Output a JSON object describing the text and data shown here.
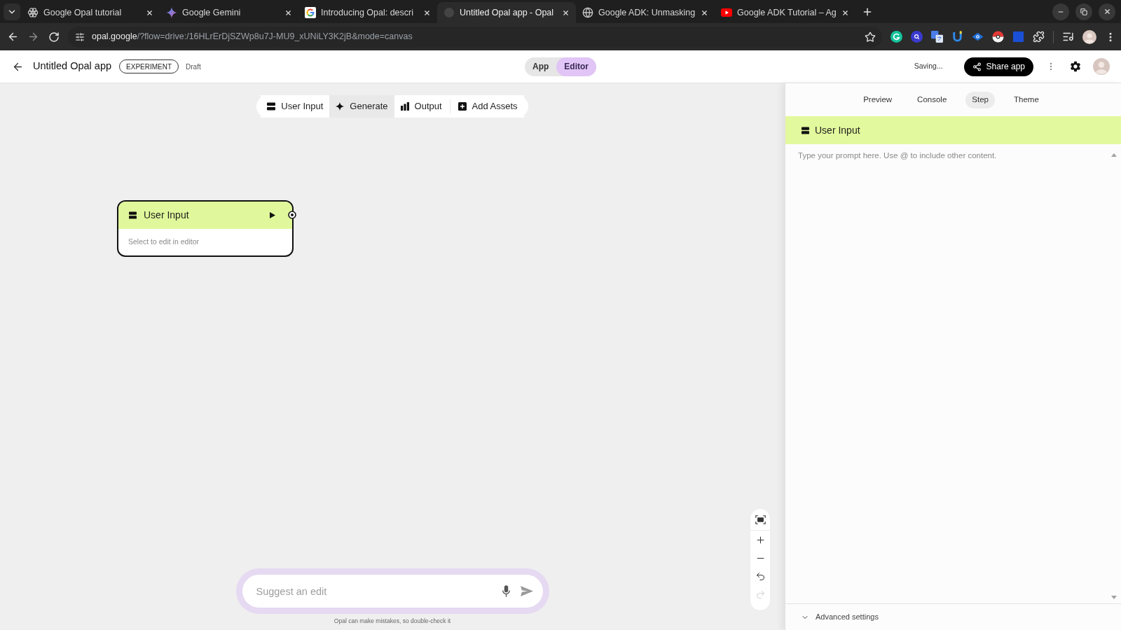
{
  "browser": {
    "tabs": [
      {
        "title": "Google Opal tutorial",
        "kind": "flower",
        "selected": false
      },
      {
        "title": "Google Gemini",
        "kind": "sparkle",
        "selected": false
      },
      {
        "title": "Introducing Opal: descri",
        "kind": "letter_g",
        "selected": false
      },
      {
        "title": "Untitled Opal app - Opal",
        "kind": "dot",
        "selected": true
      },
      {
        "title": "Google ADK: Unmasking",
        "kind": "globe",
        "selected": false
      },
      {
        "title": "Google ADK Tutorial – Ag",
        "kind": "play",
        "selected": false
      }
    ],
    "address": {
      "host": "opal.google",
      "path": "/?flow=drive:/16HLrErDjSZWp8u7J-MU9_xUNiLY3K2jB&mode=canvas"
    }
  },
  "header": {
    "title": "Untitled Opal app",
    "badge": "EXPERIMENT",
    "status": "Draft",
    "modes": [
      {
        "label": "App",
        "selected": false
      },
      {
        "label": "Editor",
        "selected": true
      }
    ],
    "save_status": "Saving...",
    "share_button": "Share app"
  },
  "canvas": {
    "toolbar": [
      {
        "label": "User Input",
        "kind": "input",
        "highlighted": false
      },
      {
        "label": "Generate",
        "kind": "generate",
        "highlighted": true
      },
      {
        "label": "Output",
        "kind": "output",
        "highlighted": false
      },
      {
        "label": "Add Assets",
        "kind": "assets",
        "highlighted": false
      }
    ],
    "nodes": [
      {
        "title": "User Input",
        "kind": "input",
        "hint": "Select to edit in editor",
        "selected": true
      }
    ],
    "zoom_controls": [
      {
        "kind": "fit",
        "disabled": false
      },
      {
        "kind": "zoom_in",
        "disabled": false
      },
      {
        "kind": "zoom_out",
        "disabled": false
      },
      {
        "kind": "undo",
        "disabled": false
      },
      {
        "kind": "redo",
        "disabled": true
      }
    ],
    "prompt_bar": {
      "placeholder": "Suggest an edit",
      "disclaimer": "Opal can make mistakes, so double-check it"
    }
  },
  "side_panel": {
    "tabs": [
      {
        "label": "Preview",
        "selected": false
      },
      {
        "label": "Console",
        "selected": false
      },
      {
        "label": "Step",
        "selected": true
      },
      {
        "label": "Theme",
        "selected": false
      }
    ],
    "step": {
      "title": "User Input",
      "kind": "input",
      "placeholder": "Type your prompt here. Use @ to include other content."
    },
    "advanced_settings": {
      "label": "Advanced settings",
      "expanded": false
    }
  }
}
